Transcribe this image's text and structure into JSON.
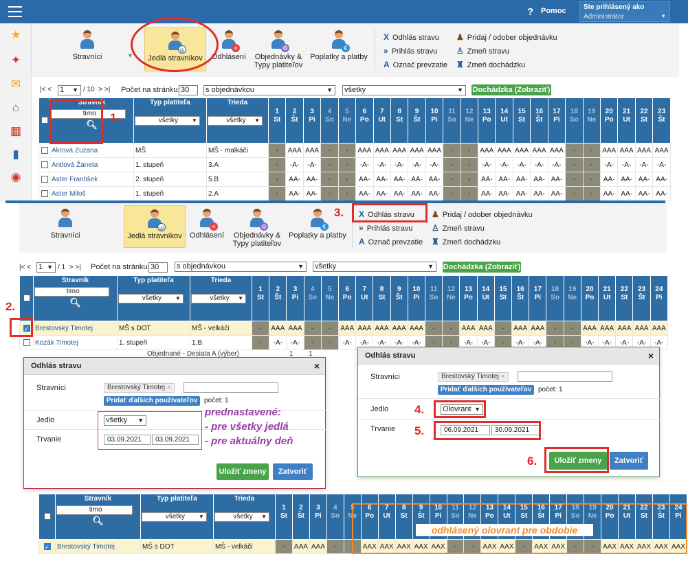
{
  "header": {
    "help_icon": "?",
    "help_label": "Pomoc",
    "logged_in_label": "Ste prihlásený ako",
    "user_role": "Administrátor"
  },
  "sidebar_icons": [
    "star-icon",
    "magic-wand-icon",
    "envelope-icon",
    "home-icon",
    "calendar-grid-icon",
    "phone-icon",
    "lifebuoy-icon"
  ],
  "toolbar": {
    "buttons": [
      "Stravníci",
      "Jedlá stravníkov",
      "Odhlásení",
      "Objednávky &",
      "Typy platiteľov",
      "Poplatky a platby"
    ],
    "actions_left": [
      {
        "letter": "X",
        "label": "Odhlás stravu"
      },
      {
        "letter": "»",
        "label": "Prihlás stravu"
      },
      {
        "letter": "A",
        "label": "Označ prevzatie"
      }
    ],
    "actions_right": [
      {
        "label": "Pridaj / odober objednávku"
      },
      {
        "label": "Zmeň stravu"
      },
      {
        "label": "Zmeň dochádzku"
      }
    ]
  },
  "pager1": {
    "nav_first": "|<",
    "nav_prev": "<",
    "page": "1",
    "of": "/ 10",
    "nav_next": ">",
    "nav_last": ">|",
    "per_page_label": "Počet na stránku:",
    "per_page": "30",
    "filter1": "s objednávkou",
    "filter2": "všetky",
    "attendance_btn": "Dochádzka (Zobraziť)"
  },
  "pager2": {
    "nav_first": "|<",
    "nav_prev": "<",
    "page": "1",
    "of": "/ 1",
    "nav_next": ">",
    "nav_last": ">|",
    "per_page_label": "Počet na stránku:",
    "per_page": "30",
    "filter1": "s objednávkou",
    "filter2": "všetky",
    "attendance_btn": "Dochádzka (Zobraziť)"
  },
  "table": {
    "col_name": "Stravník",
    "col_payer": "Typ platiteľa",
    "col_class": "Trieda",
    "search_value": "timo",
    "payer_filter": "všetky",
    "class_filter": "všetky",
    "days": [
      [
        "1",
        "St"
      ],
      [
        "2",
        "Št"
      ],
      [
        "3",
        "Pi"
      ],
      [
        "4",
        "So"
      ],
      [
        "5",
        "Ne"
      ],
      [
        "6",
        "Po"
      ],
      [
        "7",
        "Ut"
      ],
      [
        "8",
        "St"
      ],
      [
        "9",
        "Št"
      ],
      [
        "10",
        "Pi"
      ],
      [
        "11",
        "So"
      ],
      [
        "12",
        "Ne"
      ],
      [
        "13",
        "Po"
      ],
      [
        "14",
        "Ut"
      ],
      [
        "15",
        "St"
      ],
      [
        "16",
        "Št"
      ],
      [
        "17",
        "Pi"
      ],
      [
        "18",
        "So"
      ],
      [
        "19",
        "Ne"
      ],
      [
        "20",
        "Po"
      ],
      [
        "21",
        "Ut"
      ],
      [
        "22",
        "St"
      ],
      [
        "23",
        "Št"
      ],
      [
        "24",
        "Pi"
      ]
    ]
  },
  "rows1": [
    {
      "name": "Akrová Zuzana",
      "payer": "MŠ",
      "cls": "MŠ - malkáči",
      "cells": [
        "-",
        "AAA",
        "AAA",
        "-",
        "-",
        "AAA",
        "AAA",
        "AAA",
        "AAA",
        "AAA",
        "-",
        "-",
        "AAA",
        "AAA",
        "AAA",
        "AAA",
        "AAA",
        "-",
        "-",
        "AAA",
        "AAA",
        "AAA",
        "AAA"
      ]
    },
    {
      "name": "Antlová Žaneta",
      "payer": "1. stupeň",
      "cls": "3.A",
      "cells": [
        "-",
        "-A-",
        "-A-",
        "-",
        "-",
        "-A-",
        "-A-",
        "-A-",
        "-A-",
        "-A-",
        "-",
        "-",
        "-A-",
        "-A-",
        "-A-",
        "-A-",
        "-A-",
        "-",
        "-",
        "-A-",
        "-A-",
        "-A-",
        "-A-"
      ]
    },
    {
      "name": "Aster František",
      "payer": "2. stupeň",
      "cls": "5.B",
      "cells": [
        "-",
        "AA-",
        "AA-",
        "-",
        "-",
        "AA-",
        "AA-",
        "AA-",
        "AA-",
        "AA-",
        "-",
        "-",
        "AA-",
        "AA-",
        "AA-",
        "AA-",
        "AA-",
        "-",
        "-",
        "AA-",
        "AA-",
        "AA-",
        "AA-"
      ]
    },
    {
      "name": "Aster Miloš",
      "payer": "1. stupeň",
      "cls": "2.A",
      "cells": [
        "-",
        "AA-",
        "AA-",
        "-",
        "-",
        "AA-",
        "AA-",
        "AA-",
        "AA-",
        "AA-",
        "-",
        "-",
        "AA-",
        "AA-",
        "AA-",
        "AA-",
        "AA-",
        "-",
        "-",
        "AA-",
        "AA-",
        "AA-",
        "AA-"
      ]
    }
  ],
  "rows2": [
    {
      "name": "Brestovský Timotej",
      "payer": "MŠ s DOT",
      "cls": "MŠ - velkáči",
      "cells": [
        "-",
        "AAA",
        "AAA",
        "-",
        "-",
        "AAA",
        "AAA",
        "AAA",
        "AAA",
        "AAA",
        "-",
        "-",
        "AAA",
        "AAA",
        "-",
        "AAA",
        "AAA",
        "-",
        "-",
        "AAA",
        "AAA",
        "AAA",
        "AAA",
        "AAA"
      ]
    },
    {
      "name": "Kozák Timotej",
      "payer": "1. stupeň",
      "cls": "1.B",
      "cells": [
        "-",
        "-A-",
        "-A-",
        "-",
        "-",
        "-A-",
        "-A-",
        "-A-",
        "-A-",
        "-A-",
        "-",
        "-",
        "-A-",
        "-A-",
        "-",
        "-A-",
        "-A-",
        "-",
        "-",
        "-A-",
        "-A-",
        "-A-",
        "-A-",
        "-A-"
      ]
    }
  ],
  "rows3": [
    {
      "name": "Brestovský Timotej",
      "payer": "MŠ s DOT",
      "cls": "MŠ - velkáči",
      "cells": [
        "-",
        "AAA",
        "AAA",
        "-",
        "-",
        "AAX",
        "AAX",
        "AAX",
        "AAX",
        "AAX",
        "-",
        "-",
        "AAX",
        "AAX",
        "-",
        "AAX",
        "AAX",
        "-",
        "-",
        "AAX",
        "AAX",
        "AAX",
        "AAX",
        "AAX"
      ]
    }
  ],
  "footer_partial": {
    "label": "Objednané - Desiata A (výber)",
    "v1": "1",
    "v2": "1"
  },
  "dialog1": {
    "title": "Odhlás stravu",
    "close": "×",
    "lbl_diners": "Stravníci",
    "diner_tag": "Brestovský Timotej",
    "tag_x": "×",
    "add_users_btn": "Pridať ďalších používateľov",
    "count_label": "počet: 1",
    "lbl_meal": "Jedlo",
    "meal_value": "všetky",
    "lbl_duration": "Trvanie",
    "date_from": "03.09.2021",
    "date_to": "03.09.2021",
    "save_btn": "Uložiť zmeny",
    "close_btn": "Zatvoriť"
  },
  "dialog2": {
    "title": "Odhlás stravu",
    "close": "×",
    "lbl_diners": "Stravníci",
    "diner_tag": "Brestovský Timotej",
    "tag_x": "×",
    "add_users_btn": "Pridať ďalších používateľov",
    "count_label": "počet: 1",
    "lbl_meal": "Jedlo",
    "meal_value": "Olovrant",
    "lbl_duration": "Trvanie",
    "date_from": "06.09.2021",
    "date_to": "30.09.2021",
    "save_btn": "Uložiť zmeny",
    "close_btn": "Zatvoriť"
  },
  "annotations": {
    "steps": [
      "1.",
      "2.",
      "3.",
      "4.",
      "5.",
      "6."
    ],
    "preset_note": [
      "prednastavené:",
      "- pre všetky jedlá",
      "- pre aktuálny deň"
    ],
    "result_note": "odhlásený olovrant pre obdobie"
  },
  "colors": {
    "accent": "#2b6aa8",
    "header_blue": "#2e6da4",
    "selected_tab": "#f8e69a",
    "weekend": "#8c8a78",
    "annotation_red": "#e22b2b",
    "annotation_purple": "#9b3ba8",
    "annotation_orange": "#f08a2c",
    "success": "#4aa349"
  }
}
